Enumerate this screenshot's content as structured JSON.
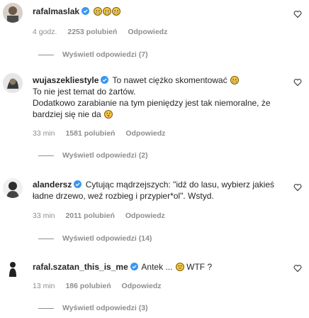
{
  "comments": [
    {
      "username": "rafalmaslak",
      "text_lines": [
        ""
      ],
      "emoji_count": 3,
      "time": "4 godz.",
      "likes": "2253 polubień",
      "reply_label": "Odpowiedz",
      "view_replies": "Wyświetl odpowiedzi (7)"
    },
    {
      "username": "wujaszekliestyle",
      "text_first": "To nawet ciężko skomentować",
      "text_line2": "To nie jest temat do żartów.",
      "text_line3": "Dodatkowo zarabianie na tym pieniędzy jest tak niemoralne, że",
      "text_line4": "bardziej się nie da",
      "time": "33 min",
      "likes": "1581 polubień",
      "reply_label": "Odpowiedz",
      "view_replies": "Wyświetl odpowiedzi (2)"
    },
    {
      "username": "alandersz",
      "text_first": "Cytując mądrzejszych: \"idź do lasu, wybierz jakieś",
      "text_line2": "ładne drzewo, weź rozbieg i przypier*ol\". Wstyd.",
      "time": "33 min",
      "likes": "2011 polubień",
      "reply_label": "Odpowiedz",
      "view_replies": "Wyświetl odpowiedzi (14)"
    },
    {
      "username": "rafal.szatan_this_is_me",
      "text_first": "Antek ...",
      "text_after": "WTF ?",
      "time": "13 min",
      "likes": "186 polubień",
      "reply_label": "Odpowiedz",
      "view_replies": "Wyświetl odpowiedzi (3)"
    }
  ],
  "colors": {
    "verified": "#3897f0",
    "secondary_text": "#8e8e8e",
    "primary_text": "#262626"
  }
}
